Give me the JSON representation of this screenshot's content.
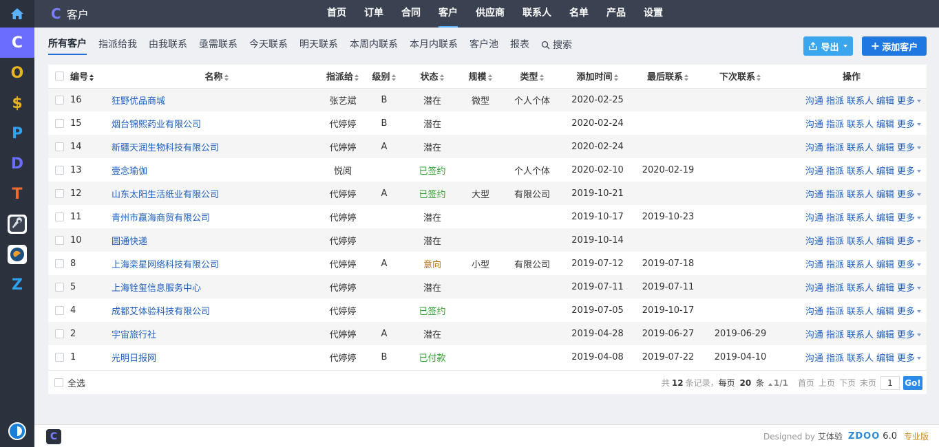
{
  "appbar": {
    "apps": [
      {
        "letter": "C",
        "name": "crm",
        "color": "#ffffff",
        "active": true
      },
      {
        "letter": "O",
        "name": "oa",
        "color": "#e7b51f"
      },
      {
        "letter": "$",
        "name": "cash",
        "color": "#e7b51f"
      },
      {
        "letter": "P",
        "name": "project",
        "color": "#2ea3f2"
      },
      {
        "letter": "D",
        "name": "doc",
        "color": "#6a6dfd"
      },
      {
        "letter": "T",
        "name": "team",
        "color": "#f26b2e"
      },
      {
        "letter": "Z",
        "name": "zentao",
        "color": "#2ea3f2"
      }
    ]
  },
  "topbar": {
    "brand": "客户",
    "nav": [
      "首页",
      "订单",
      "合同",
      "客户",
      "供应商",
      "联系人",
      "名单",
      "产品",
      "设置"
    ],
    "active_nav": "客户"
  },
  "subnav": {
    "tabs": [
      "所有客户",
      "指派给我",
      "由我联系",
      "亟需联系",
      "今天联系",
      "明天联系",
      "本周内联系",
      "本月内联系",
      "客户池",
      "报表"
    ],
    "active_tab": "所有客户",
    "search_label": "搜索",
    "export_label": "导出",
    "add_label": "添加客户"
  },
  "table": {
    "headers": {
      "id": "编号",
      "name": "名称",
      "assigned": "指派给",
      "level": "级别",
      "status": "状态",
      "size": "规模",
      "type": "类型",
      "created": "添加时间",
      "last": "最后联系",
      "next": "下次联系",
      "ops": "操作"
    },
    "ops": [
      "沟通",
      "指派",
      "联系人",
      "编辑",
      "更多"
    ],
    "rows": [
      {
        "id": "16",
        "name": "狂野优品商城",
        "assigned": "张艺斌",
        "level": "B",
        "status": "潜在",
        "size": "微型",
        "type": "个人个体",
        "created": "2020-02-25",
        "last": "",
        "next": ""
      },
      {
        "id": "15",
        "name": "烟台锦熙药业有限公司",
        "assigned": "代婷婷",
        "level": "B",
        "status": "潜在",
        "size": "",
        "type": "",
        "created": "2020-02-24",
        "last": "",
        "next": ""
      },
      {
        "id": "14",
        "name": "新疆天润生物科技有限公司",
        "assigned": "代婷婷",
        "level": "A",
        "status": "潜在",
        "size": "",
        "type": "",
        "created": "2020-02-24",
        "last": "",
        "next": ""
      },
      {
        "id": "13",
        "name": "壹念瑜伽",
        "assigned": "悦阅",
        "level": "",
        "status": "已签约",
        "size": "",
        "type": "个人个体",
        "created": "2020-02-10",
        "last": "2020-02-19",
        "next": ""
      },
      {
        "id": "12",
        "name": "山东太阳生活纸业有限公司",
        "assigned": "代婷婷",
        "level": "A",
        "status": "已签约",
        "size": "大型",
        "type": "有限公司",
        "created": "2019-10-21",
        "last": "",
        "next": ""
      },
      {
        "id": "11",
        "name": "青州市赢海商贸有限公司",
        "assigned": "代婷婷",
        "level": "",
        "status": "潜在",
        "size": "",
        "type": "",
        "created": "2019-10-17",
        "last": "2019-10-23",
        "next": ""
      },
      {
        "id": "10",
        "name": "圆通快递",
        "assigned": "代婷婷",
        "level": "",
        "status": "潜在",
        "size": "",
        "type": "",
        "created": "2019-10-14",
        "last": "",
        "next": ""
      },
      {
        "id": "8",
        "name": "上海栾星网络科技有限公司",
        "assigned": "代婷婷",
        "level": "A",
        "status": "意向",
        "size": "小型",
        "type": "有限公司",
        "created": "2019-07-12",
        "last": "2019-07-18",
        "next": ""
      },
      {
        "id": "5",
        "name": "上海铨玺信息服务中心",
        "assigned": "代婷婷",
        "level": "",
        "status": "潜在",
        "size": "",
        "type": "",
        "created": "2019-07-11",
        "last": "2019-07-11",
        "next": ""
      },
      {
        "id": "4",
        "name": "成都艾体验科技有限公司",
        "assigned": "代婷婷",
        "level": "",
        "status": "已签约",
        "size": "",
        "type": "",
        "created": "2019-07-05",
        "last": "2019-10-17",
        "next": ""
      },
      {
        "id": "2",
        "name": "宇宙旅行社",
        "assigned": "代婷婷",
        "level": "A",
        "status": "潜在",
        "size": "",
        "type": "",
        "created": "2019-04-28",
        "last": "2019-06-27",
        "next": "2019-06-29"
      },
      {
        "id": "1",
        "name": "光明日报网",
        "assigned": "代婷婷",
        "level": "B",
        "status": "已付款",
        "size": "",
        "type": "",
        "created": "2019-04-08",
        "last": "2019-07-22",
        "next": "2019-04-10"
      }
    ],
    "status_colors": {
      "已签约": "#2ea12e",
      "已付款": "#2ea12e",
      "意向": "#b4700c"
    }
  },
  "footer_table": {
    "select_all": "全选",
    "total_prefix": "共",
    "total": "12",
    "total_suffix": "条记录，",
    "per_page_prefix": "每页",
    "per_page": "20",
    "per_page_suffix": "条",
    "page_info": "1/1",
    "first": "首页",
    "prev": "上页",
    "next": "下页",
    "last": "末页",
    "page_input": "1",
    "go": "Go!"
  },
  "footer": {
    "designed_by": "Designed by",
    "company": "艾体验",
    "product": "ZDOO",
    "version": "6.0",
    "edition": "专业版"
  }
}
